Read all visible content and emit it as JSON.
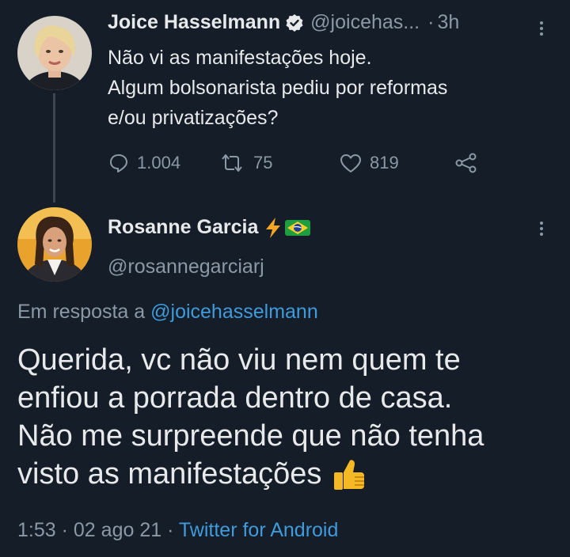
{
  "tweet1": {
    "display_name": "Joice Hasselmann",
    "handle": "@joicehas...",
    "separator": "·",
    "time": "3h",
    "text_lines": [
      "Não vi as manifestações hoje.",
      "Algum bolsonarista pediu por reformas",
      "e/ou privatizações?"
    ],
    "replies": "1.004",
    "retweets": "75",
    "likes": "819",
    "icons": {
      "verified": "verified-badge-icon",
      "menu": "more-vertical-icon",
      "reply": "reply-icon",
      "retweet": "retweet-icon",
      "like": "heart-icon",
      "share": "share-icon"
    }
  },
  "tweet2": {
    "display_name": "Rosanne Garcia",
    "handle": "@rosannegarciarj",
    "name_emojis": [
      "lightning-icon",
      "brazil-flag-icon"
    ],
    "reply_prefix": "Em resposta a",
    "reply_to": "@joicehasselmann",
    "text_lines": [
      "Querida, vc não viu nem quem te",
      "enfiou a porrada dentro de casa.",
      "Não me surpreende que não tenha",
      "visto as manifestações"
    ],
    "text_emoji": "thumbs-up-icon",
    "time": "1:53",
    "date": "02 ago 21",
    "separator": "·",
    "client": "Twitter for Android"
  },
  "colors": {
    "background": "#151d28",
    "text": "#e7e9ea",
    "muted": "#8b98a5",
    "link": "#3f9bdc"
  }
}
